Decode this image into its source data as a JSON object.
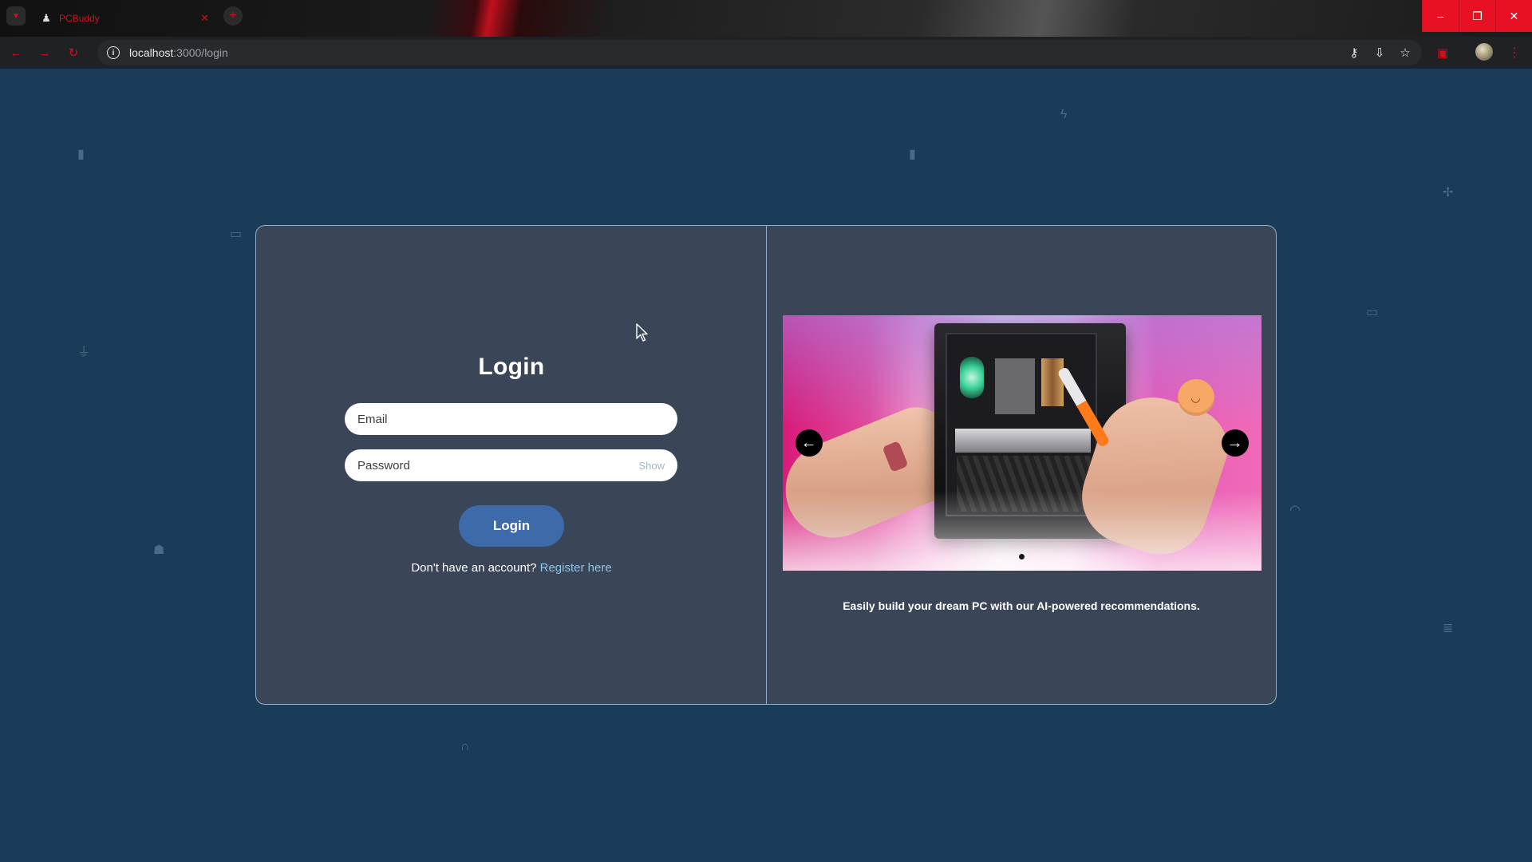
{
  "browser": {
    "tab_title": "PCBuddy",
    "tab_close_glyph": "✕",
    "new_tab_glyph": "+",
    "url_host": "localhost",
    "url_path": ":3000/login",
    "info_glyph": "i",
    "window_controls": {
      "minimize": "–",
      "restore": "❐",
      "close": "✕"
    },
    "nav": {
      "back": "←",
      "forward": "→",
      "reload": "↻"
    },
    "omnibox_actions": {
      "password_key": "⚷",
      "install": "⇩",
      "bookmark": "☆"
    },
    "menu_glyph": "⋮"
  },
  "login": {
    "title": "Login",
    "email_placeholder": "Email",
    "password_placeholder": "Password",
    "show_label": "Show",
    "button_label": "Login",
    "register_prompt": "Don't have an account? ",
    "register_link": "Register here"
  },
  "carousel": {
    "prev_glyph": "←",
    "next_glyph": "→",
    "slide_count": 1,
    "active_slide": 0,
    "caption": "Easily build your dream PC with our AI-powered recommendations.",
    "smiley_glyph": "◡"
  },
  "background_icons": [
    {
      "name": "battery-icon",
      "glyph": "▮"
    },
    {
      "name": "memory-icon",
      "glyph": "▮"
    },
    {
      "name": "lightning-icon",
      "glyph": "ϟ"
    },
    {
      "name": "fan-icon",
      "glyph": "✢"
    },
    {
      "name": "keyboard-icon",
      "glyph": "▭"
    },
    {
      "name": "keyboard-icon",
      "glyph": "▭"
    },
    {
      "name": "plug-icon",
      "glyph": "⏚"
    },
    {
      "name": "wifi-icon",
      "glyph": "◠"
    },
    {
      "name": "hdd-icon",
      "glyph": "☗"
    },
    {
      "name": "server-icon",
      "glyph": "≣"
    },
    {
      "name": "headset-icon",
      "glyph": "∩"
    }
  ],
  "colors": {
    "page_background": "#1b3c58",
    "card_background": "#3b4558",
    "card_border": "#8fb0c8",
    "button_primary": "#3d6aa8",
    "link": "#8cc6e8",
    "browser_accent": "#d0101c",
    "window_close": "#e81123"
  }
}
